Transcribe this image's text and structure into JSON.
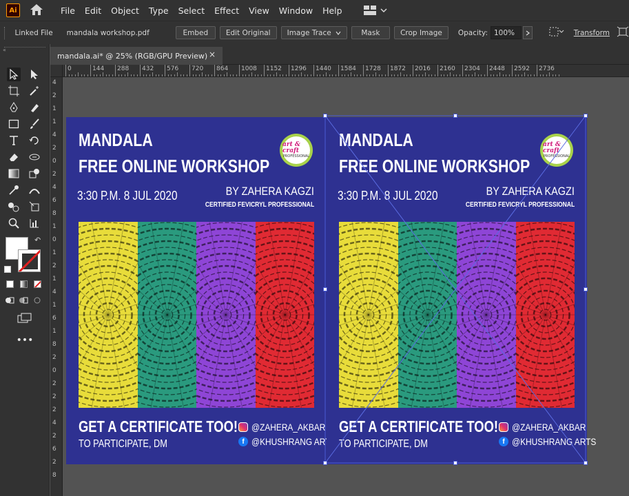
{
  "app": {
    "logo_text": "Ai"
  },
  "menu": [
    "File",
    "Edit",
    "Object",
    "Type",
    "Select",
    "Effect",
    "View",
    "Window",
    "Help"
  ],
  "control_bar": {
    "linked_file": "Linked File",
    "file_name": "mandala workshop.pdf",
    "embed": "Embed",
    "edit_original": "Edit Original",
    "image_trace": "Image Trace",
    "mask": "Mask",
    "crop_image": "Crop Image",
    "opacity_label": "Opacity:",
    "opacity_value": "100%",
    "transform": "Transform"
  },
  "document_tab": {
    "title": "mandala.ai* @ 25% (RGB/GPU Preview)",
    "close": "×"
  },
  "ruler_h": [
    "0",
    "144",
    "288",
    "432",
    "576",
    "720",
    "864",
    "1008",
    "1152",
    "1296",
    "1440",
    "1584",
    "1728",
    "1872",
    "2016",
    "2160",
    "2304",
    "2448",
    "2592",
    "2736"
  ],
  "ruler_v": [
    "4",
    "2",
    "1",
    "1",
    "4",
    "2",
    "0",
    "2",
    "4",
    "6",
    "8",
    "1",
    "0",
    "1",
    "2",
    "1",
    "4",
    "1",
    "6",
    "1",
    "8",
    "2",
    "0",
    "2",
    "2",
    "2",
    "4",
    "2",
    "6",
    "2",
    "8"
  ],
  "poster": {
    "title_line1": "MANDALA",
    "title_line2": "FREE ONLINE WORKSHOP",
    "date": "3:30 P.M. 8 JUL 2020",
    "by": "BY ZAHERA KAGZI",
    "certified": "CERTIFIED FEVICRYL PROFESSIONAL",
    "badge_line1": "art & craft",
    "badge_line2": "PROFESSIONAL",
    "cta": "GET A CERTIFICATE TOO!",
    "participate": "TO PARTICIPATE, DM",
    "instagram": "@ZAHERA_AKBAR",
    "facebook": "@KHUSHRANG ARTS",
    "facebook_glyph": "f"
  },
  "colors": {
    "poster_bg": "#2e3191",
    "strip_yellow": "#e8dc3a",
    "strip_teal": "#2a9a7e",
    "strip_purple": "#8e45d6",
    "strip_red": "#e02a33",
    "selection": "#4a5bd4"
  },
  "icons": [
    "home-icon",
    "workspace-icon",
    "selection-tool-icon",
    "direct-selection-icon",
    "artboard-tool-icon",
    "magic-wand-icon",
    "pen-tool-icon",
    "curvature-icon",
    "rectangle-tool-icon",
    "paintbrush-icon",
    "type-tool-icon",
    "rotate-tool-icon",
    "eraser-icon",
    "width-tool-icon",
    "gradient-icon",
    "shape-builder-icon",
    "eyedropper-icon",
    "blend-icon",
    "symbol-sprayer-icon",
    "slice-icon",
    "zoom-icon",
    "graph-icon",
    "fill-stroke-icon",
    "screen-mode-icon",
    "more-tools-icon"
  ]
}
